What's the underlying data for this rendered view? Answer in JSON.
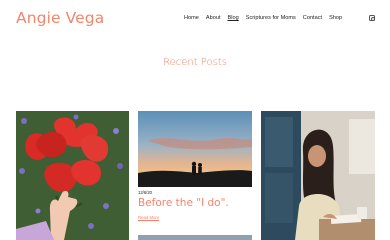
{
  "site": {
    "title": "Angie Vega"
  },
  "nav": {
    "items": [
      {
        "label": "Home"
      },
      {
        "label": "About"
      },
      {
        "label": "Blog",
        "active": true
      },
      {
        "label": "Scriptures for Moms"
      },
      {
        "label": "Contact"
      },
      {
        "label": "Shop"
      }
    ]
  },
  "main": {
    "section_title": "Recent Posts"
  },
  "posts": [
    {
      "image": "red-tulips-photo"
    },
    {
      "image": "sunset-couple-silhouette-photo",
      "category": "12/6/20",
      "title": "Before the \"I do\".",
      "read_more": "Read More"
    },
    {
      "image": "woman-writing-journal-photo"
    }
  ],
  "colors": {
    "accent": "#f0866d",
    "text": "#222222"
  }
}
